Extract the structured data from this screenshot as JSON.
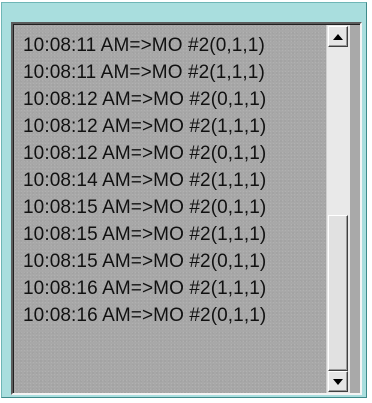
{
  "listbox": {
    "items": [
      "10:08:11 AM=>MO #2(0,1,1)",
      "10:08:11 AM=>MO #2(1,1,1)",
      "10:08:12 AM=>MO #2(0,1,1)",
      "10:08:12 AM=>MO #2(1,1,1)",
      "10:08:12 AM=>MO #2(0,1,1)",
      "10:08:14 AM=>MO #2(1,1,1)",
      "10:08:15 AM=>MO #2(0,1,1)",
      "10:08:15 AM=>MO #2(1,1,1)",
      "10:08:15 AM=>MO #2(0,1,1)",
      "10:08:16 AM=>MO #2(1,1,1)",
      "10:08:16 AM=>MO #2(0,1,1)"
    ]
  },
  "scrollbar": {
    "up_icon": "arrow-up-icon",
    "down_icon": "arrow-down-icon",
    "thumb_start_fraction": 0.52,
    "thumb_end_fraction": 1.0
  },
  "colors": {
    "frame": "#a9dede",
    "list_background": "#a8a8a8",
    "text": "#111111",
    "scroll_track": "#e9e9e9"
  }
}
